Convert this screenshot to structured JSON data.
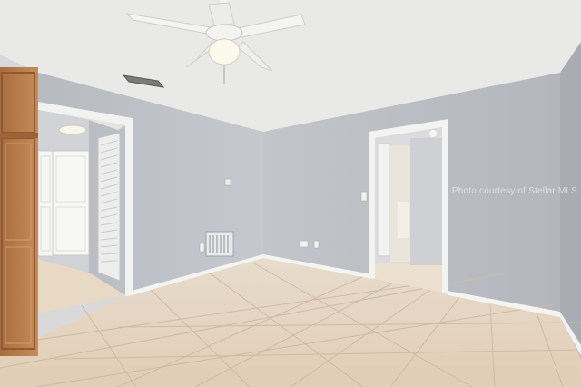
{
  "photo": {
    "watermark": "Photo courtesy of Stellar MLS",
    "colors": {
      "wall": "#b9bcc2",
      "ceiling": "#e8e8e6",
      "floor_tile": "#e6d6c3",
      "grout": "#cdbba6",
      "trim": "#f3f3f1",
      "cabinet": "#b77a4a"
    }
  }
}
